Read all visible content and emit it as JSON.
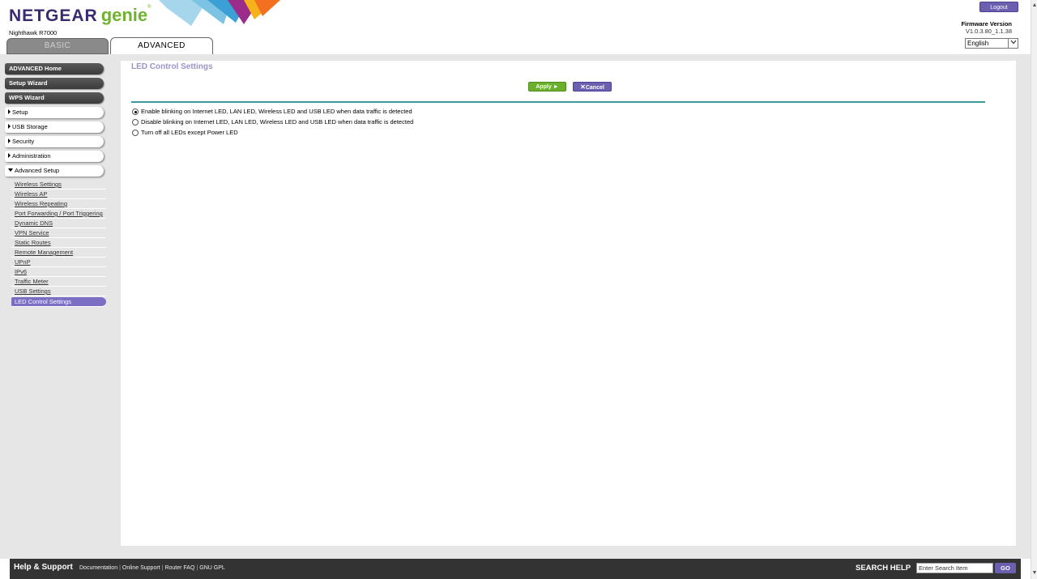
{
  "header": {
    "brand": "NETGEAR",
    "genie": "genie",
    "trademark": "®",
    "model": "Nighthawk R7000",
    "tabs": {
      "basic": "BASIC",
      "advanced": "ADVANCED"
    },
    "logout": "Logout",
    "firmware_label": "Firmware Version",
    "firmware_value": "V1.0.3.80_1.1.38",
    "language": "English"
  },
  "sidebar": {
    "dark_items": [
      "ADVANCED Home",
      "Setup Wizard",
      "WPS Wizard"
    ],
    "sections": [
      "Setup",
      "USB Storage",
      "Security",
      "Administration",
      "Advanced Setup"
    ],
    "submenu": [
      "Wireless Settings",
      "Wireless AP",
      "Wireless Repeating",
      "Port Forwarding / Port Triggering",
      "Dynamic DNS",
      "VPN Service",
      "Static Routes",
      "Remote Management",
      "UPnP",
      "IPv6",
      "Traffic Meter",
      "USB Settings",
      "LED Control Settings"
    ],
    "active_submenu": "LED Control Settings"
  },
  "main": {
    "title": "LED Control Settings",
    "apply": "Apply ►",
    "cancel": "Cancel",
    "options": [
      {
        "label": "Enable blinking on Internet LED, LAN LED, Wireless LED and USB LED when data traffic is detected",
        "checked": true
      },
      {
        "label": "Disable blinking on Internet LED, LAN LED, Wireless LED and USB LED when data traffic is detected",
        "checked": false
      },
      {
        "label": "Turn off all LEDs except Power LED",
        "checked": false
      }
    ]
  },
  "footer": {
    "help_title": "Help & Support",
    "links": [
      "Documentation",
      "Online Support",
      "Router FAQ",
      "GNU GPL"
    ],
    "search_label": "SEARCH HELP",
    "search_placeholder": "Enter Search Item",
    "go": "GO"
  },
  "colors": {
    "accent_purple": "#6b5fb0",
    "apply_green": "#6ab02c",
    "divider_teal": "#3b9a9c",
    "active_submenu": "#7b6fc4"
  }
}
